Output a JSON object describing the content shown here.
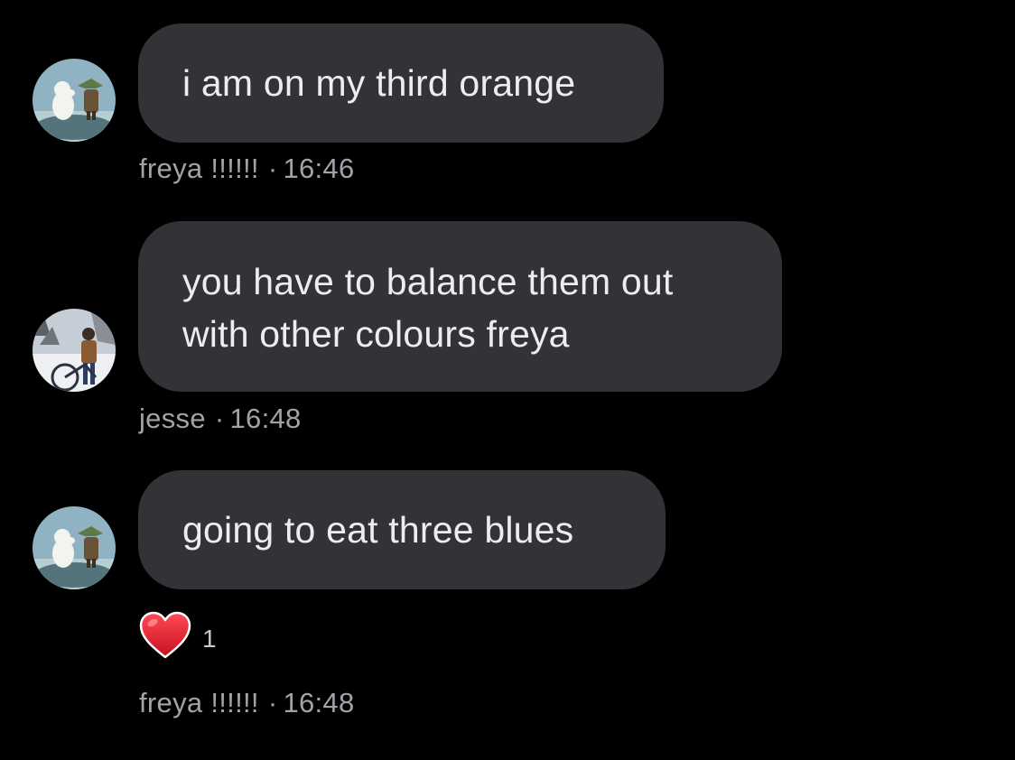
{
  "messages": [
    {
      "text": "i am on my third orange",
      "sender": "freya !!!!!!",
      "time": "16:46"
    },
    {
      "text_lines": [
        "you have to balance them out",
        "with other colours freya"
      ],
      "sender": "jesse",
      "time": "16:48"
    },
    {
      "text": "going to eat three blues",
      "sender": "freya !!!!!!",
      "time": "16:48",
      "reaction": {
        "icon": "heart-icon",
        "count": "1"
      }
    }
  ],
  "separator": "·",
  "colors": {
    "background": "#000000",
    "bubble": "#333337",
    "message_text": "#ececf1",
    "meta_text": "#a2a2a8",
    "reaction_heart": "#e0202e"
  }
}
